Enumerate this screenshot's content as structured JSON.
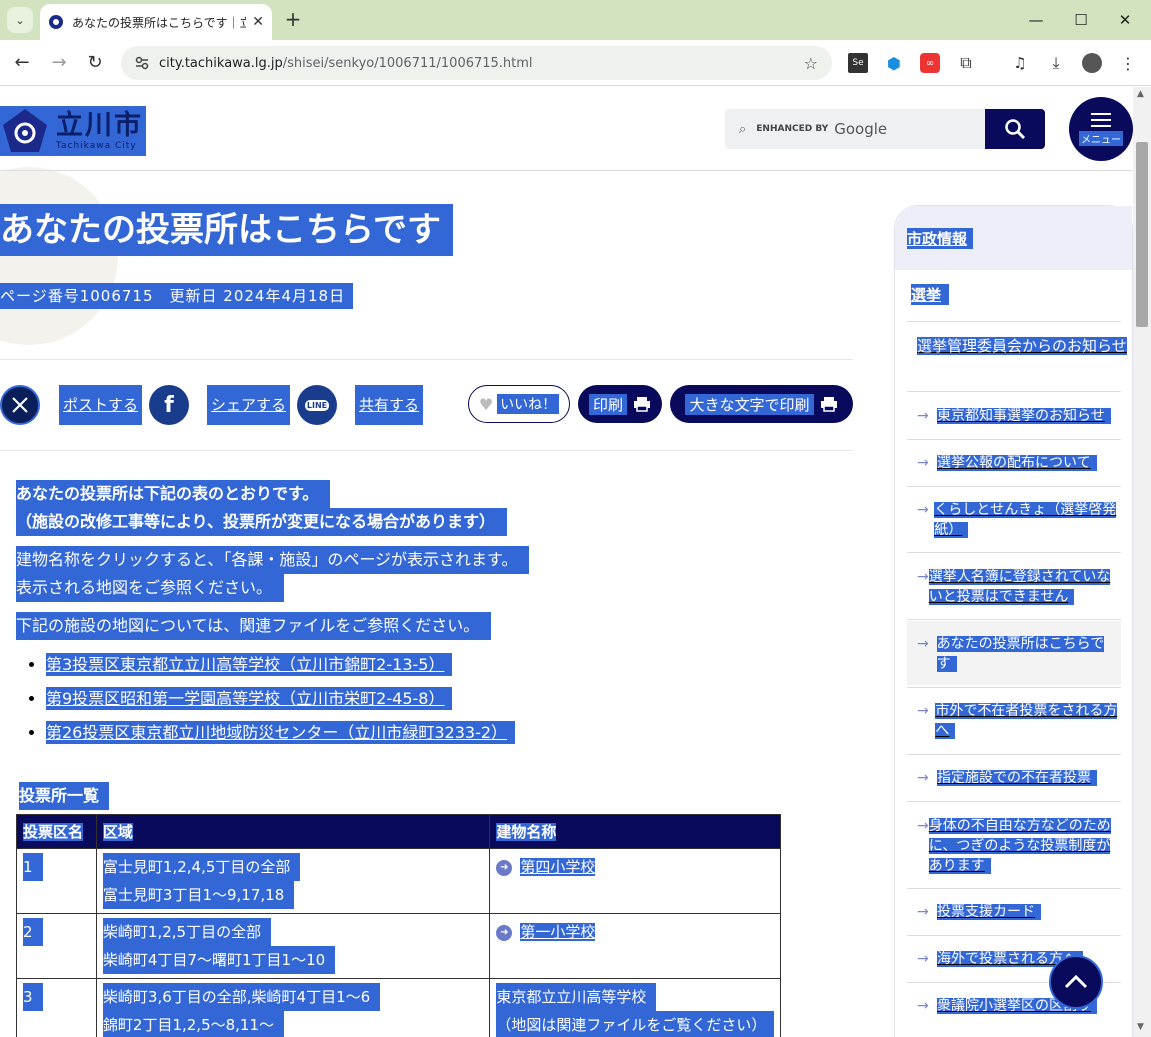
{
  "browser": {
    "tab_title": "あなたの投票所はこちらです｜立川",
    "url_host": "city.tachikawa.lg.jp",
    "url_path": "/shisei/senkyo/1006711/1006715.html"
  },
  "header": {
    "logo_jp": "立川市",
    "logo_en": "Tachikawa City",
    "search_enhanced": "ENHANCED BY",
    "search_google": "Google",
    "menu_label": "メニュー"
  },
  "article": {
    "title": "あなたの投票所はこちらです",
    "meta": "ページ番号1006715　更新日 2024年4月18日",
    "share": {
      "x_label": "ポストする",
      "facebook_label": "シェアする",
      "line_label": "共有する",
      "line_icon_text": "LINE",
      "like_label": "いいね！",
      "print_label": "印刷",
      "print_large_label": "大きな文字で印刷"
    },
    "para1_line1": "あなたの投票所は下記の表のとおりです。",
    "para1_line2": "（施設の改修工事等により、投票所が変更になる場合があります）",
    "para2_line1": "建物名称をクリックすると、「各課・施設」のページが表示されます。",
    "para2_line2": "表示される地図をご参照ください。",
    "para3": "下記の施設の地図については、関連ファイルをご参照ください。",
    "bullets": [
      "第3投票区東京都立立川高等学校（立川市錦町2-13-5）",
      "第9投票区昭和第一学園高等学校（立川市栄町2-45-8）",
      "第26投票区東京都立川地域防災センター（立川市緑町3233-2）"
    ]
  },
  "table": {
    "caption": "投票所一覧",
    "headers": [
      "投票区名",
      "区域",
      "建物名称"
    ],
    "rows": [
      {
        "no": "1",
        "area1": "富士見町1,2,4,5丁目の全部",
        "area2": "富士見町3丁目1～9,17,18",
        "building1": "第四小学校",
        "building2": ""
      },
      {
        "no": "2",
        "area1": "柴崎町1,2,5丁目の全部",
        "area2": "柴崎町4丁目7～曙町1丁目1～10",
        "building1": "第一小学校",
        "building2": ""
      },
      {
        "no": "3",
        "area1": "柴崎町3,6丁目の全部,柴崎町4丁目1～6",
        "area2": "錦町2丁目1,2,5～8,11～",
        "building1": "東京都立立川高等学校",
        "building2": "（地図は関連ファイルをご覧ください）"
      }
    ]
  },
  "sidebar": {
    "title": "市政情報",
    "subtitle": "選挙",
    "category": "選挙管理委員会からのお知らせ",
    "items": [
      "東京都知事選挙のお知らせ",
      "選挙公報の配布について",
      "くらしとせんきょ（選挙啓発紙）",
      "選挙人名簿に登録されていないと投票はできません",
      "あなたの投票所はこちらです",
      "市外で不在者投票をされる方へ",
      "指定施設での不在者投票",
      "身体の不自由な方などのために、つぎのような投票制度があります",
      "投票支援カード",
      "海外で投票される方へ",
      "衆議院小選挙区の区割り"
    ]
  }
}
